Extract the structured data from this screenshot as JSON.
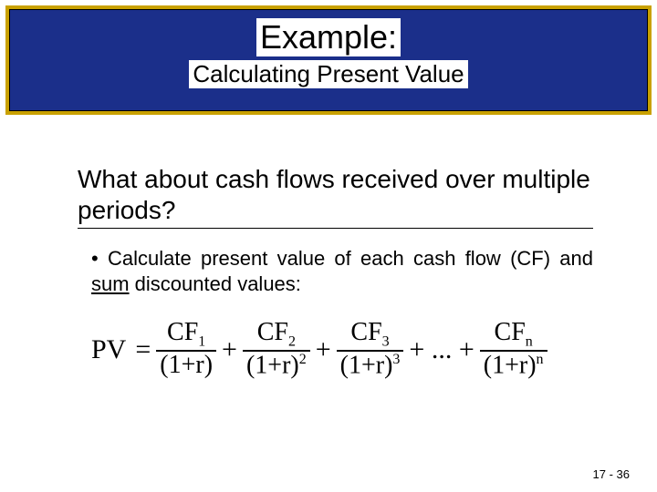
{
  "header": {
    "title": "Example:",
    "subtitle": "Calculating Present Value"
  },
  "question": "What about cash flows received over multiple periods?",
  "bullet": {
    "marker": "•",
    "text_before": "Calculate present value of each cash flow (CF) and ",
    "sum_word": "sum",
    "text_after": " discounted values:"
  },
  "formula": {
    "pv": "PV",
    "eq": "=",
    "plus": "+",
    "dots": "+ ... +",
    "terms": [
      {
        "num": "CF",
        "num_sub": "1",
        "den": "(1+r)",
        "den_sup": ""
      },
      {
        "num": "CF",
        "num_sub": "2",
        "den": "(1+r)",
        "den_sup": "2"
      },
      {
        "num": "CF",
        "num_sub": "3",
        "den": "(1+r)",
        "den_sup": "3"
      },
      {
        "num": "CF",
        "num_sub": "n",
        "den": "(1+r)",
        "den_sup": "n"
      }
    ]
  },
  "pagenum": "17 - 36"
}
